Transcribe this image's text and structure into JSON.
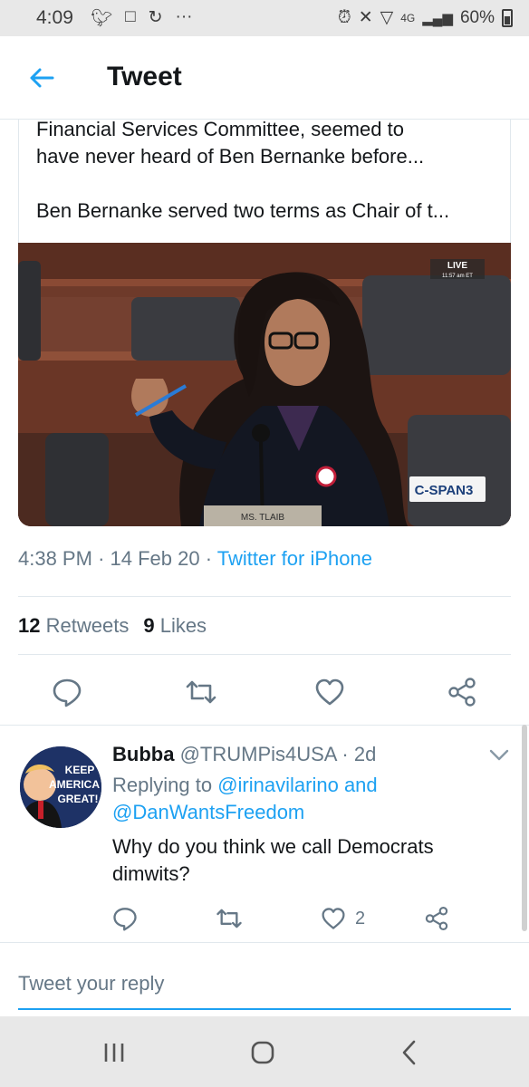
{
  "status_bar": {
    "time": "4:09",
    "network": "4G",
    "battery": "60%",
    "more": "···"
  },
  "header": {
    "title": "Tweet"
  },
  "tweet": {
    "text_line1": "Financial Services Committee, seemed to",
    "text_line2": "have never heard of Ben Bernanke before...",
    "text_line3": "Ben Bernanke served two terms as Chair of t...",
    "media": {
      "live_label": "LIVE",
      "live_time": "11:57 am ET",
      "nameplate": "MS. TLAIB",
      "channel_logo": "C-SPAN3"
    },
    "time": "4:38 PM",
    "date": "14 Feb 20",
    "source": "Twitter for iPhone",
    "retweets_count": "12",
    "retweets_label": "Retweets",
    "likes_count": "9",
    "likes_label": "Likes"
  },
  "reply": {
    "display_name": "Bubba",
    "handle": "@TRUMPis4USA",
    "age": "2d",
    "replying_prefix": "Replying to",
    "mention1": "@irinavilarino",
    "conjunction": "and",
    "mention2": "@DanWantsFreedom",
    "text": "Why do you think we call Democrats dimwits?",
    "like_count": "2",
    "avatar_text": "KEEP AMERICA GREAT!"
  },
  "compose": {
    "placeholder": "Tweet your reply"
  },
  "colors": {
    "accent": "#1da1f2",
    "muted": "#657786",
    "text": "#14171a",
    "divider": "#e1e8ed"
  },
  "icons": [
    "back-arrow-icon",
    "reply-icon",
    "retweet-icon",
    "like-icon",
    "share-icon",
    "chevron-down-icon",
    "recent-apps-icon",
    "home-icon",
    "back-icon"
  ]
}
